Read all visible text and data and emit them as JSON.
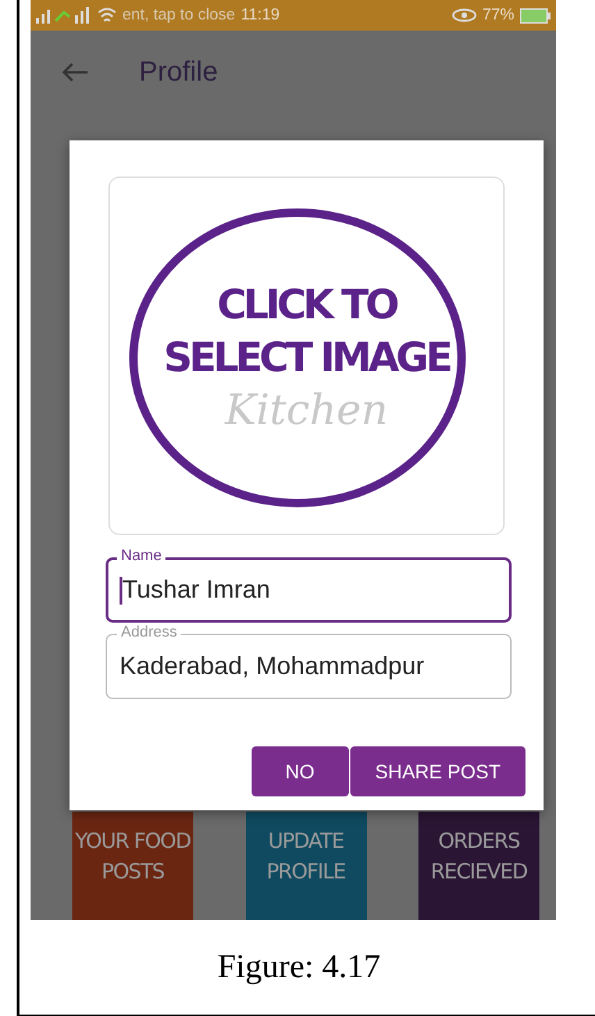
{
  "status_bar": {
    "notification": "ent, tap to close",
    "time": "11:19",
    "battery": "77%"
  },
  "app_bar": {
    "title": "Profile"
  },
  "dialog": {
    "image": {
      "lines": [
        "CLICK TO",
        "SELECT IMAGE"
      ],
      "watermark": "Kitchen"
    },
    "fields": [
      {
        "label": "Name",
        "value": "Tushar Imran",
        "focused": true
      },
      {
        "label": "Address",
        "value": "Kaderabad, Mohammadpur",
        "focused": false
      }
    ],
    "buttons": [
      "NO",
      "SHARE POST"
    ]
  },
  "tiles": [
    {
      "label": "YOUR FOOD POSTS",
      "color": "#6b2612"
    },
    {
      "label": "UPDATE PROFILE",
      "color": "#0f4a60"
    },
    {
      "label": "ORDERS RECIEVED",
      "color": "#2a1535"
    }
  ],
  "caption": "Figure: 4.17"
}
